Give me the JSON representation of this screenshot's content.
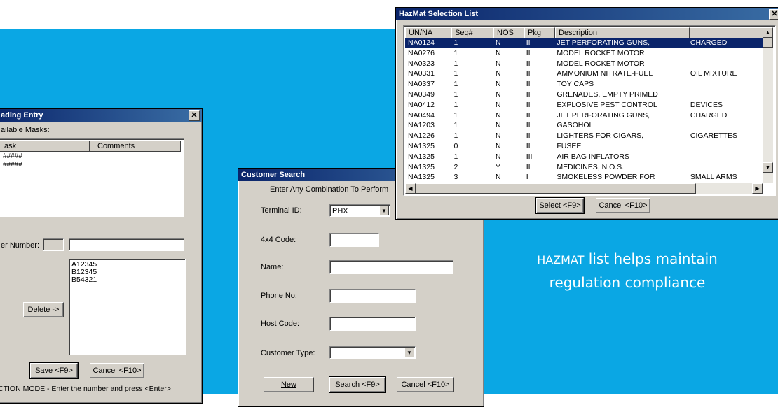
{
  "caption": {
    "line1_smallcaps": "HAZMAT",
    "line1_rest": " list helps maintain",
    "line2": "regulation compliance"
  },
  "leading_entry": {
    "title": "ading Entry",
    "masks_label": "ailable Masks:",
    "col_mask": "ask",
    "col_comments": "Comments",
    "mask_values": [
      "#####",
      "#####"
    ],
    "number_label": "er Number:",
    "items": [
      "A12345",
      "B12345",
      "B54321"
    ],
    "delete_label": "Delete ->",
    "save_label": "Save <F9>",
    "cancel_label": "Cancel <F10>",
    "status_text": "CTION MODE - Enter the number and press <Enter>",
    "close_glyph": "✕"
  },
  "customer_search": {
    "title": "Customer Search",
    "instruction": "Enter Any Combination To Perform",
    "terminal_label": "Terminal ID:",
    "terminal_value": "PHX",
    "code_label": "4x4 Code:",
    "name_label": "Name:",
    "phone_label": "Phone No:",
    "host_label": "Host Code:",
    "type_label": "Customer Type:",
    "new_label": "New",
    "search_label": "Search <F9>",
    "cancel_label": "Cancel <F10>"
  },
  "hazmat": {
    "title": "HazMat Selection List",
    "close_glyph": "✕",
    "columns": [
      "UN/NA",
      "Seq#",
      "NOS",
      "Pkg",
      "Description",
      ""
    ],
    "rows": [
      [
        "NA0124",
        "1",
        "N",
        "II",
        "JET PERFORATING GUNS,",
        "CHARGED"
      ],
      [
        "NA0276",
        "1",
        "N",
        "II",
        "MODEL ROCKET MOTOR",
        ""
      ],
      [
        "NA0323",
        "1",
        "N",
        "II",
        "MODEL ROCKET MOTOR",
        ""
      ],
      [
        "NA0331",
        "1",
        "N",
        "II",
        "AMMONIUM NITRATE-FUEL",
        "OIL MIXTURE"
      ],
      [
        "NA0337",
        "1",
        "N",
        "II",
        "TOY CAPS",
        ""
      ],
      [
        "NA0349",
        "1",
        "N",
        "II",
        "GRENADES, EMPTY PRIMED",
        ""
      ],
      [
        "NA0412",
        "1",
        "N",
        "II",
        "EXPLOSIVE PEST CONTROL",
        "DEVICES"
      ],
      [
        "NA0494",
        "1",
        "N",
        "II",
        "JET PERFORATING GUNS,",
        "CHARGED"
      ],
      [
        "NA1203",
        "1",
        "N",
        "II",
        "GASOHOL",
        ""
      ],
      [
        "NA1226",
        "1",
        "N",
        "II",
        "LIGHTERS FOR CIGARS,",
        "CIGARETTES"
      ],
      [
        "NA1325",
        "0",
        "N",
        "II",
        "FUSEE",
        ""
      ],
      [
        "NA1325",
        "1",
        "N",
        "III",
        "AIR BAG INFLATORS",
        ""
      ],
      [
        "NA1325",
        "2",
        "Y",
        "II",
        "MEDICINES, N.O.S.",
        ""
      ],
      [
        "NA1325",
        "3",
        "N",
        "I",
        "SMOKELESS POWDER FOR",
        "SMALL ARMS"
      ]
    ],
    "select_label": "Select <F9>",
    "cancel_label": "Cancel <F10>"
  }
}
